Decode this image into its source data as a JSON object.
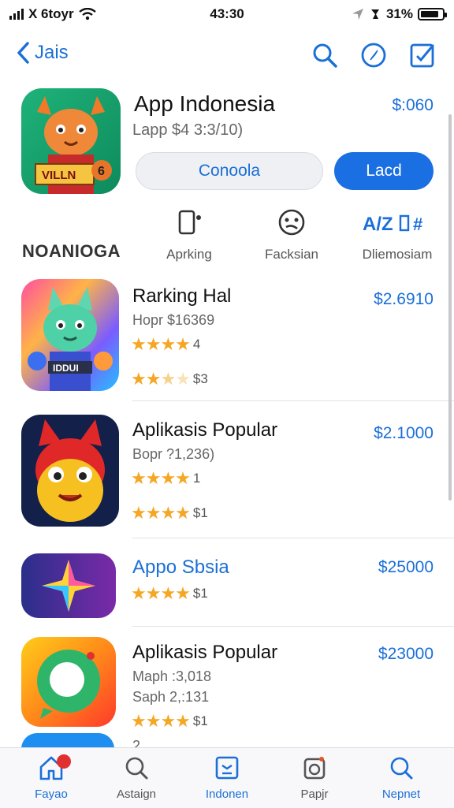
{
  "status": {
    "carrier": "X 6toyr",
    "time": "43:30",
    "battery": "31%"
  },
  "nav": {
    "back_label": "Jais"
  },
  "hero": {
    "title": "App Indonesia",
    "subtitle": "Lapp  $4 3:3/10)",
    "price": "$:060",
    "icon_text": "VILLN",
    "icon_badge": "6",
    "secondary_button": "Conoola",
    "primary_button": "Lacd"
  },
  "section_label": "NOANIOGA",
  "categories": [
    {
      "label": "Aprking",
      "icon": "phone-icon"
    },
    {
      "label": "Facksian",
      "icon": "face-icon"
    },
    {
      "label": "Dliemosiam",
      "icon": "az-icon"
    }
  ],
  "apps": [
    {
      "title": "Rarking Hal",
      "sub": "Hopr  $16369",
      "price": "$2.6910",
      "rating1": "4",
      "rating2": "$3",
      "stars1": 4,
      "stars2": 2.5,
      "icon_text": "IDDUI"
    },
    {
      "title": "Aplikasis Popular",
      "sub": "Bopr  ?1,236)",
      "price": "$2.1000",
      "rating1": "1",
      "rating2": "$1",
      "stars1": 4,
      "stars2": 4
    },
    {
      "title": "Appo Sbsia",
      "price": "$25000",
      "rating1": "$1",
      "stars1": 4
    },
    {
      "title": "Aplikasis Popular",
      "sub": "Maph  :3,018",
      "sub2": "Saph  2,:131",
      "price": "$23000",
      "rating1": "$1",
      "stars1": 4
    }
  ],
  "partial_row_text": "2",
  "tabs": [
    {
      "label": "Fayao",
      "icon": "home-icon",
      "active": true
    },
    {
      "label": "Astaign",
      "icon": "search-icon",
      "active": false
    },
    {
      "label": "Indonen",
      "icon": "calendar-icon",
      "active": true
    },
    {
      "label": "Papjr",
      "icon": "camera-icon",
      "active": false
    },
    {
      "label": "Nepnet",
      "icon": "search-icon",
      "active": true
    }
  ],
  "colors": {
    "accent": "#1a6fd8",
    "primary_button": "#1a6fe3",
    "star": "#f5a623",
    "badge": "#e03030"
  }
}
